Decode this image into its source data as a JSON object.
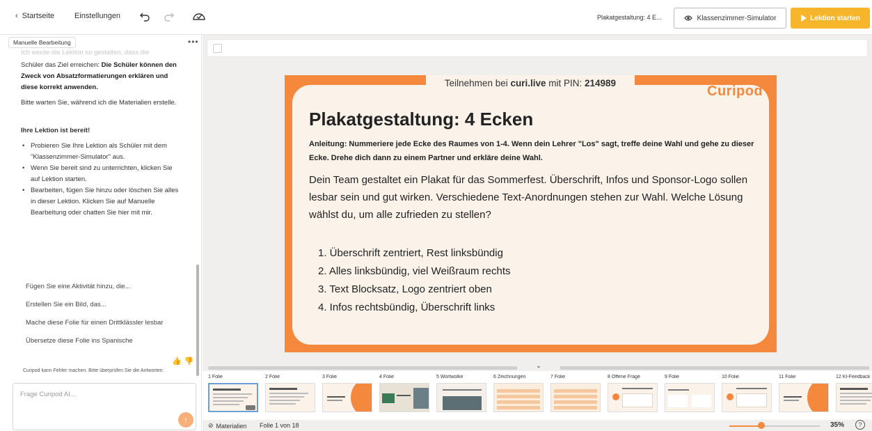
{
  "topbar": {
    "back_label": "Startseite",
    "settings_label": "Einstellungen",
    "lesson_title": "Plakatgestaltung: 4 E...",
    "simulator_label": "Klassenzimmer-Simulator",
    "start_label": "Lektion starten"
  },
  "leftpanel": {
    "manual_tag": "Manuelle Bearbeitung",
    "more": "•••",
    "faded_line": "Ich werde die Lektion so gestalten, dass die",
    "goal_prefix": "Schüler das Ziel erreichen: ",
    "goal_bold": "Die Schüler können den Zweck von Absatzformatierungen erklären und diese korrekt anwenden.",
    "wait_text": "Bitte warten Sie, während ich die Materialien erstelle.",
    "ready_title": "Ihre Lektion ist bereit!",
    "bullets": [
      "Probieren Sie Ihre Lektion als Schüler mit dem \"Klassenzimmer-Simulator\" aus.",
      "Wenn Sie bereit sind zu unterrichten, klicken Sie auf Lektion starten.",
      "Bearbeiten, fügen Sie hinzu oder löschen Sie alles in dieser Lektion. Klicken Sie auf Manuelle Bearbeitung oder chatten Sie hier mit mir."
    ],
    "suggestions": [
      "Fügen Sie eine Aktivität hinzu, die...",
      "Erstellen Sie ein Bild, das...",
      "Mache diese Folie für einen Drittklässler lesbar",
      "Übersetze diese Folie ins Spanische"
    ],
    "thumb_up": "👍",
    "thumb_down": "👎",
    "disclaimer": "Curipod kann Fehler machen. Bitte überprüfen Sie die Antworten.",
    "input_placeholder": "Frage Curipod AI...",
    "input_value": "",
    "send_glyph": "↑"
  },
  "slide": {
    "pin_prefix": "Teilnehmen bei ",
    "pin_site": "curi.live",
    "pin_middle": " mit PIN: ",
    "pin_code": "214989",
    "logo": "Curipod",
    "title": "Plakatgestaltung: 4 Ecken",
    "instruction": "Anleitung: Nummeriere jede Ecke des Raumes von 1-4. Wenn dein Lehrer \"Los\" sagt, treffe deine Wahl und gehe zu dieser Ecke. Drehe dich dann zu einem Partner und erkläre deine Wahl.",
    "body": "Dein Team gestaltet ein Plakat für das Sommerfest. Überschrift, Infos und Sponsor-Logo sollen lesbar sein und gut wirken. Verschiedene Text-Anordnungen stehen zur Wahl. Welche Lösung wählst du, um alle zufrieden zu stellen?",
    "options": [
      "1. Überschrift zentriert, Rest linksbündig",
      "2. Alles linksbündig, viel Weißraum rechts",
      "3. Text Blocksatz, Logo zentriert oben",
      "4. Infos rechtsbündig, Überschrift links"
    ]
  },
  "collapse_glyph": "⌄",
  "filmstrip": [
    {
      "label": "1 Folie",
      "style": "text",
      "selected": true
    },
    {
      "label": "2 Folie",
      "style": "text",
      "selected": false
    },
    {
      "label": "3 Folie",
      "style": "orange",
      "selected": false
    },
    {
      "label": "4 Folie",
      "style": "image",
      "selected": false
    },
    {
      "label": "5 Wortwolke",
      "style": "image2",
      "selected": false
    },
    {
      "label": "6 Zeichnungen",
      "style": "list",
      "selected": false
    },
    {
      "label": "7 Folie",
      "style": "list",
      "selected": false
    },
    {
      "label": "8 Offene Frage",
      "style": "question",
      "selected": false
    },
    {
      "label": "9 Folie",
      "style": "columns",
      "selected": false
    },
    {
      "label": "10 Folie",
      "style": "question",
      "selected": false
    },
    {
      "label": "11 Folie",
      "style": "orange",
      "selected": false
    },
    {
      "label": "12 KI-Feedback",
      "style": "text",
      "selected": false
    }
  ],
  "bottombar": {
    "materials_label": "Materialien",
    "folio_label": "Folie 1 von 18",
    "zoom_label": "35%",
    "zoom_fraction": 0.35,
    "help_glyph": "?"
  },
  "colors": {
    "accent_orange": "#f4883d",
    "start_button": "#f7b52b",
    "slide_bg": "#fbf3ea",
    "selected_border": "#6a9fd8"
  }
}
